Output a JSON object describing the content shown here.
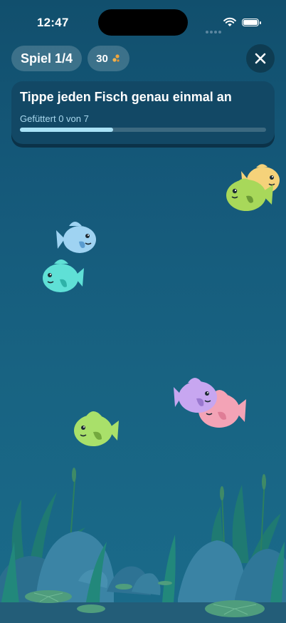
{
  "status": {
    "time": "12:47"
  },
  "header": {
    "game_label": "Spiel 1/4",
    "coins": "30"
  },
  "task": {
    "title": "Tippe jeden Fisch genau einmal an",
    "progress_text": "Gefüttert 0 von 7",
    "progress": 0.38
  },
  "fish": [
    {
      "color": "#f5d27a",
      "name": "yellow-fish"
    },
    {
      "color": "#a8d85a",
      "name": "green-fish-top"
    },
    {
      "color": "#9fd3f2",
      "name": "blue-fish"
    },
    {
      "color": "#5fe0d6",
      "name": "teal-fish"
    },
    {
      "color": "#c7a6f0",
      "name": "purple-fish"
    },
    {
      "color": "#f3a3b6",
      "name": "pink-fish"
    },
    {
      "color": "#a9e06a",
      "name": "green-fish-bottom"
    }
  ]
}
